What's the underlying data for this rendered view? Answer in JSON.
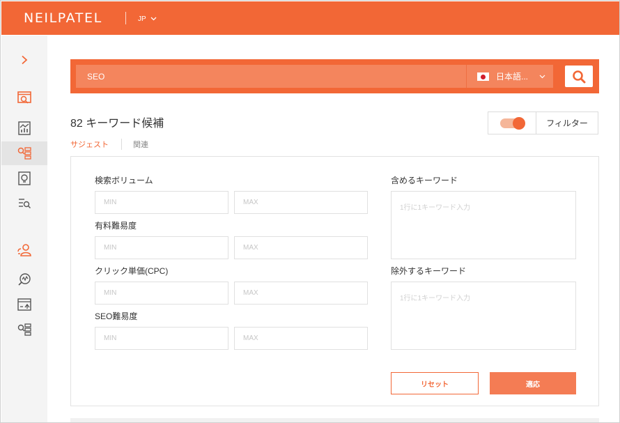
{
  "header": {
    "brand": "NEILPATEL",
    "language_code": "JP"
  },
  "search": {
    "query": "SEO",
    "language_label": "日本語...",
    "language_flag": "japan-flag-icon"
  },
  "results": {
    "title": "82 キーワード候補",
    "filter_toggle_on": true,
    "filter_label": "フィルター",
    "tabs": [
      {
        "label": "サジェスト",
        "active": true
      },
      {
        "label": "関連",
        "active": false
      }
    ]
  },
  "filters": {
    "search_volume": {
      "label": "検索ボリューム",
      "min_placeholder": "MIN",
      "max_placeholder": "MAX"
    },
    "paid_difficulty": {
      "label": "有料難易度",
      "min_placeholder": "MIN",
      "max_placeholder": "MAX"
    },
    "cpc": {
      "label": "クリック単価(CPC)",
      "min_placeholder": "MIN",
      "max_placeholder": "MAX"
    },
    "seo_difficulty": {
      "label": "SEO難易度",
      "min_placeholder": "MIN",
      "max_placeholder": "MAX"
    },
    "include_keywords": {
      "label": "含めるキーワード",
      "placeholder": "1行に1キーワード入力"
    },
    "exclude_keywords": {
      "label": "除外するキーワード",
      "placeholder": "1行に1キーワード入力"
    },
    "reset_label": "リセット",
    "apply_label": "適応"
  },
  "colors": {
    "accent": "#f26736",
    "accent_light": "#f4855d",
    "sidebar_bg": "#f4f4f4"
  },
  "sidebar": {
    "items": [
      {
        "name": "expand-arrow-icon"
      },
      {
        "name": "dashboard-icon"
      },
      {
        "name": "chart-icon"
      },
      {
        "name": "keyword-ideas-icon"
      },
      {
        "name": "content-ideas-icon"
      },
      {
        "name": "site-audit-icon"
      },
      {
        "name": "user-group-icon"
      },
      {
        "name": "traffic-analyzer-icon"
      },
      {
        "name": "rank-tracker-icon"
      },
      {
        "name": "backlinks-icon"
      }
    ]
  }
}
